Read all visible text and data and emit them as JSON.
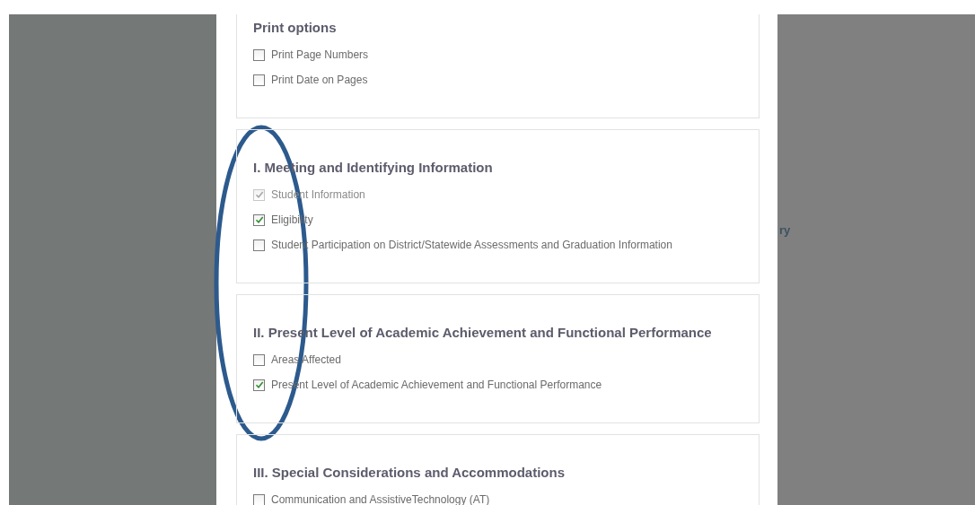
{
  "background": {
    "fragment_text": "ry"
  },
  "sections": [
    {
      "title": "Print options",
      "items": [
        {
          "label": "Print Page Numbers",
          "checked": false,
          "disabled": false
        },
        {
          "label": "Print Date on Pages",
          "checked": false,
          "disabled": false
        }
      ]
    },
    {
      "title": "I. Meeting and Identifying Information",
      "items": [
        {
          "label": "Student Information",
          "checked": true,
          "disabled": true
        },
        {
          "label": "Eligibility",
          "checked": true,
          "disabled": false
        },
        {
          "label": "Student Participation on District/Statewide Assessments and Graduation Information",
          "checked": false,
          "disabled": false
        }
      ]
    },
    {
      "title": "II. Present Level of Academic Achievement and Functional Performance",
      "items": [
        {
          "label": "Areas Affected",
          "checked": false,
          "disabled": false
        },
        {
          "label": "Present Level of Academic Achievement and Functional Performance",
          "checked": true,
          "disabled": false
        }
      ]
    },
    {
      "title": "III. Special Considerations and Accommodations",
      "items": [
        {
          "label": "Communication and AssistiveTechnology (AT)",
          "checked": false,
          "disabled": false
        }
      ]
    }
  ]
}
